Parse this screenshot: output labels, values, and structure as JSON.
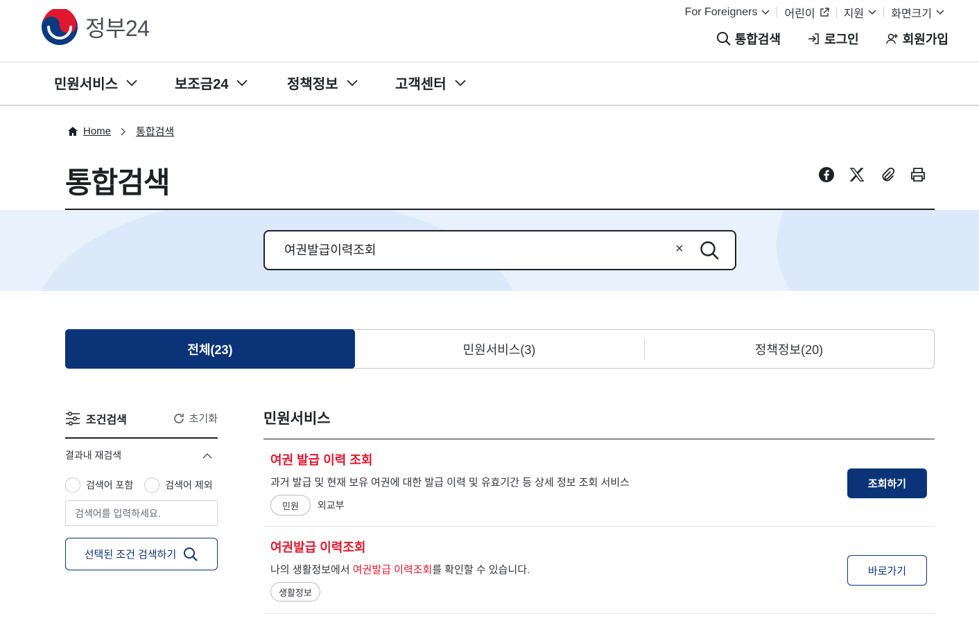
{
  "header": {
    "logo_text": "정부24",
    "util": [
      {
        "label": "For Foreigners"
      },
      {
        "label": "어린이"
      },
      {
        "label": "지원"
      },
      {
        "label": "화면크기"
      }
    ],
    "actions": {
      "search": "통합검색",
      "login": "로그인",
      "signup": "회원가입"
    }
  },
  "gnb": [
    "민원서비스",
    "보조금24",
    "정책정보",
    "고객센터"
  ],
  "breadcrumb": {
    "home": "Home",
    "current": "통합검색"
  },
  "page_title": "통합검색",
  "search": {
    "value": "여권발급이력조회",
    "clear": "×"
  },
  "tabs": [
    {
      "label": "전체(23)",
      "active": true
    },
    {
      "label": "민원서비스(3)",
      "active": false
    },
    {
      "label": "정책정보(20)",
      "active": false
    }
  ],
  "sidebar": {
    "title": "조건검색",
    "reset": "초기화",
    "refine_title": "결과내 재검색",
    "include": "검색어 포함",
    "exclude": "검색어 제외",
    "placeholder": "검색어를 입력하세요.",
    "search_button": "선택된 조건 검색하기"
  },
  "results": {
    "section_title": "민원서비스",
    "items": [
      {
        "title": "여권 발급 이력 조회",
        "desc": "과거 발급 및 현재 보유 여권에 대한 발급 이력 및 유효기간 등 상세 정보 조회 서비스",
        "chip": "민원",
        "org": "외교부",
        "button": "조회하기"
      },
      {
        "title": "여권발급 이력조회",
        "desc_before": "나의 생활정보에서 ",
        "desc_hl": "여권발급 이력조회",
        "desc_after": "를 확인할 수 있습니다.",
        "chip": "생활정보",
        "button": "바로가기"
      }
    ]
  },
  "colors": {
    "primary": "#0b3478",
    "highlight": "#e0182d",
    "band": "#e8f1fc"
  }
}
